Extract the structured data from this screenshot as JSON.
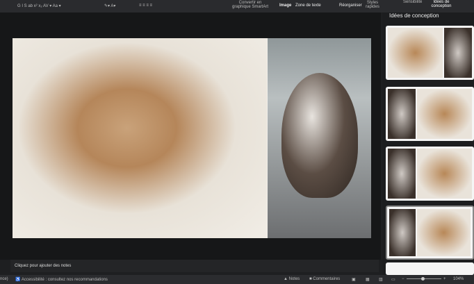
{
  "toolbar": {
    "format_buttons": "G  I  S  ab  x²  x₂  AV ▾  Aa ▾",
    "convert_smartart": "Convertir en graphique SmartArt",
    "image": "Image",
    "text_box": "Zone de texte",
    "rearrange": "Réorganiser",
    "quick_styles": "Styles rapides",
    "sensitivity": "Sensibilité",
    "design_ideas": "Idées de conception"
  },
  "notes": {
    "placeholder": "Cliquez pour ajouter des notes"
  },
  "panel": {
    "title": "Idées de conception"
  },
  "status": {
    "left": "nce)",
    "accessibility": "Accessibilité : consultez nos recommandations",
    "notes": "Notes",
    "comments": "Commentaires",
    "zoom": "104%"
  }
}
